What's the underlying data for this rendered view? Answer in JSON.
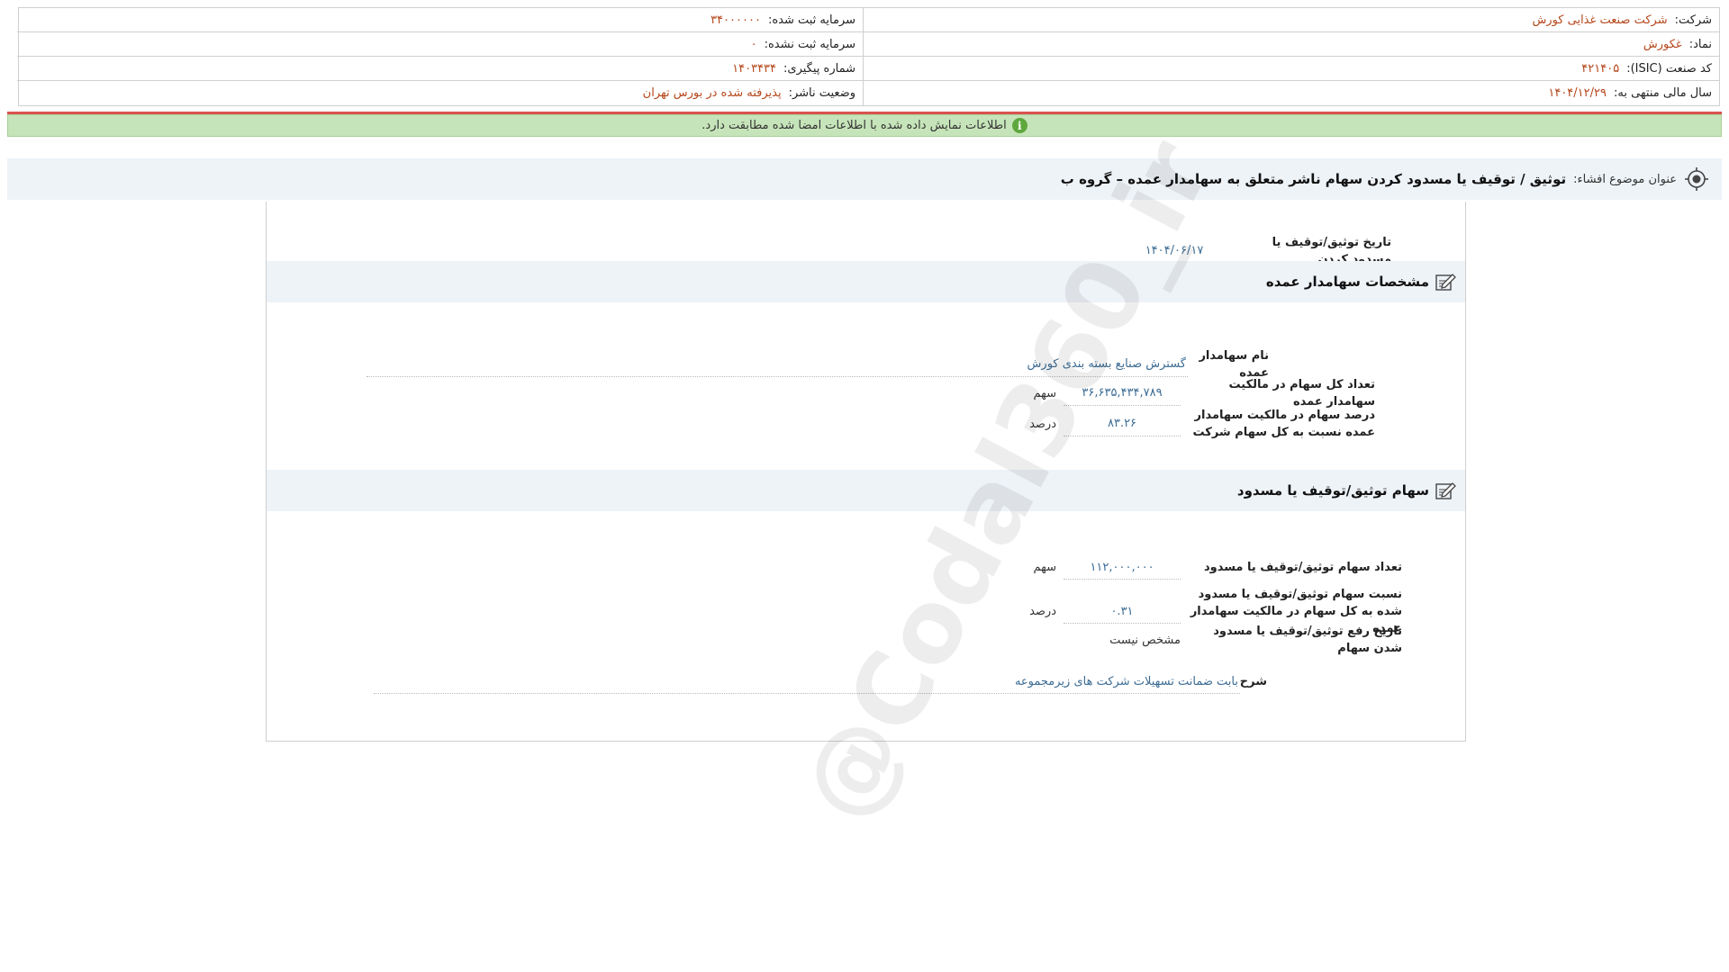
{
  "company_info": {
    "right": [
      {
        "label": "شرکت:",
        "value": "شرکت صنعت غذایی کورش"
      },
      {
        "label": "نماد:",
        "value": "غکورش"
      },
      {
        "label": "کد صنعت (ISIC):",
        "value": "۴۲۱۴۰۵"
      },
      {
        "label": "سال مالی منتهی به:",
        "value": "۱۴۰۴/۱۲/۲۹"
      }
    ],
    "left": [
      {
        "label": "سرمایه ثبت شده:",
        "value": "۳۴۰۰۰۰۰۰"
      },
      {
        "label": "سرمایه ثبت نشده:",
        "value": "۰"
      },
      {
        "label": "شماره پیگیری:",
        "value": "۱۴۰۳۴۳۴"
      },
      {
        "label": "وضعیت ناشر:",
        "value": "پذیرفته شده در بورس تهران"
      }
    ]
  },
  "notice": {
    "text": "اطلاعات نمایش داده شده با اطلاعات امضا شده مطابقت دارد.",
    "icon": "info-icon"
  },
  "title_bar": {
    "label": "عنوان موضوع افشاء:",
    "text": "توثیق / توقیف یا مسدود کردن سهام ناشر متعلق به سهامدار عمده – گروه ب"
  },
  "form": {
    "pledge_date": {
      "label": "تاریخ توثیق/توقیف یا مسدود کردن",
      "value": "۱۴۰۴/۰۶/۱۷"
    },
    "shareholder_section": {
      "title": "مشخصات سهامدار عمده",
      "name": {
        "label": "نام سهامدار عمده",
        "value": "گسترش صنایع بسته بندی کورش"
      },
      "total_shares": {
        "label": "تعداد کل سهام در مالکیت سهامدار عمده",
        "value": "۳۶,۶۳۵,۴۳۴,۷۸۹",
        "unit": "سهم"
      },
      "ownership_pct": {
        "label": "درصد سهام در مالکیت سهامدار عمده نسبت به کل سهام شرکت",
        "value": "۸۳.۲۶",
        "unit": "درصد"
      }
    },
    "pledged_section": {
      "title": "سهام توثیق/توقیف یا مسدود",
      "count": {
        "label": "تعداد سهام توثیق/توقیف یا مسدود",
        "value": "۱۱۲,۰۰۰,۰۰۰",
        "unit": "سهم"
      },
      "ratio": {
        "label": "نسبت سهام توثیق/توقیف یا مسدود شده به کل سهام در مالکیت سهامدار عمده",
        "value": "۰.۳۱",
        "unit": "درصد"
      },
      "release_date": {
        "label": "تاریخ رفع توثیق/توقیف یا مسدود شدن سهام",
        "value": "مشخص نیست"
      },
      "description": {
        "label": "شرح",
        "value": "بابت ضمانت تسهیلات شرکت های زیرمجموعه"
      }
    }
  },
  "watermark": "@Codal360_ir",
  "colors": {
    "accent_value": "#b5471b",
    "field_value": "#3c6c94",
    "notice_bg": "#c6e4b9",
    "alert_line": "#d9534f"
  }
}
